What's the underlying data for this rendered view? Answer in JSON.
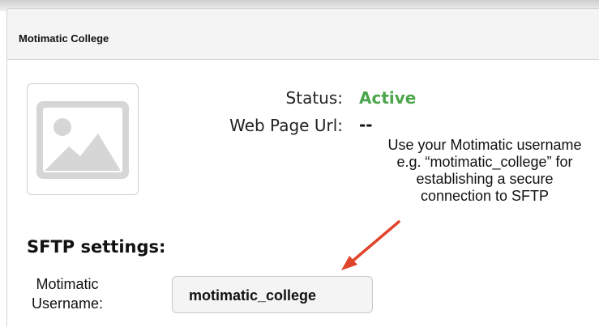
{
  "card": {
    "title": "Motimatic College"
  },
  "image": {
    "icon": "image-placeholder-icon"
  },
  "info": {
    "status_label": "Status:",
    "status_value": "Active",
    "status_color": "#4ca64c",
    "url_label": "Web Page Url:",
    "url_value": "--"
  },
  "callout": {
    "text": "Use your Motimatic username e.g. “motimatic_college” for establishing a secure connection to SFTP",
    "arrow_color": "#e0452c"
  },
  "sftp": {
    "section_title": "SFTP settings:",
    "username_label": "Motimatic Username:",
    "username_value": "motimatic_college"
  }
}
